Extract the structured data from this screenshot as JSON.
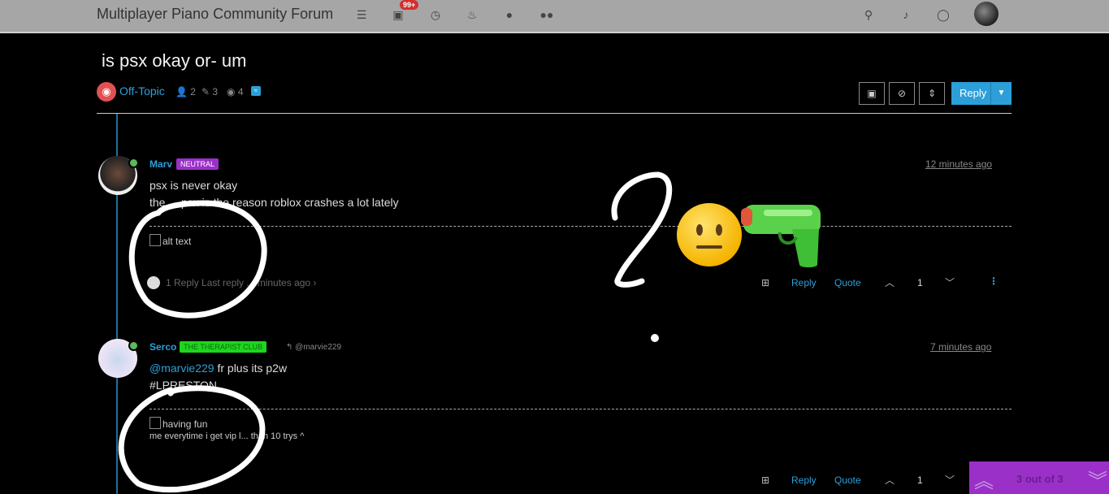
{
  "header": {
    "title": "Multiplayer Piano Community Forum",
    "notifications_badge": "99+"
  },
  "topic": {
    "title": "is psx okay or- um",
    "category": "Off-Topic",
    "posters": "2",
    "posts": "3",
    "views": "4",
    "reply_label": "Reply"
  },
  "posts": [
    {
      "username": "Marv",
      "group": "NEUTRAL",
      "group_color": "#9b30c9",
      "timestamp": "12 minutes ago",
      "line1": "psx is never okay",
      "line2": "the ... psx is the reason roblox crashes a lot lately",
      "image_alt": "alt text",
      "replies": "1 Reply Last reply ... minutes ago",
      "reply_label": "Reply",
      "quote_label": "Quote",
      "votes": "1"
    },
    {
      "username": "Serco",
      "group": "THE THERAPIST CLUB",
      "group_color": "#1ed61e",
      "reply_to": "@marvie229",
      "timestamp": "7 minutes ago",
      "mention": "@marvie229",
      "line1_rest": " fr plus its p2w",
      "line2": "#LPRESTON",
      "image_alt": "having fun",
      "caption": "me everytime i get vip l... than 10 trys ^",
      "reply_label": "Reply",
      "quote_label": "Quote",
      "votes": "1"
    }
  ],
  "pager": {
    "label": "3 out of 3"
  }
}
